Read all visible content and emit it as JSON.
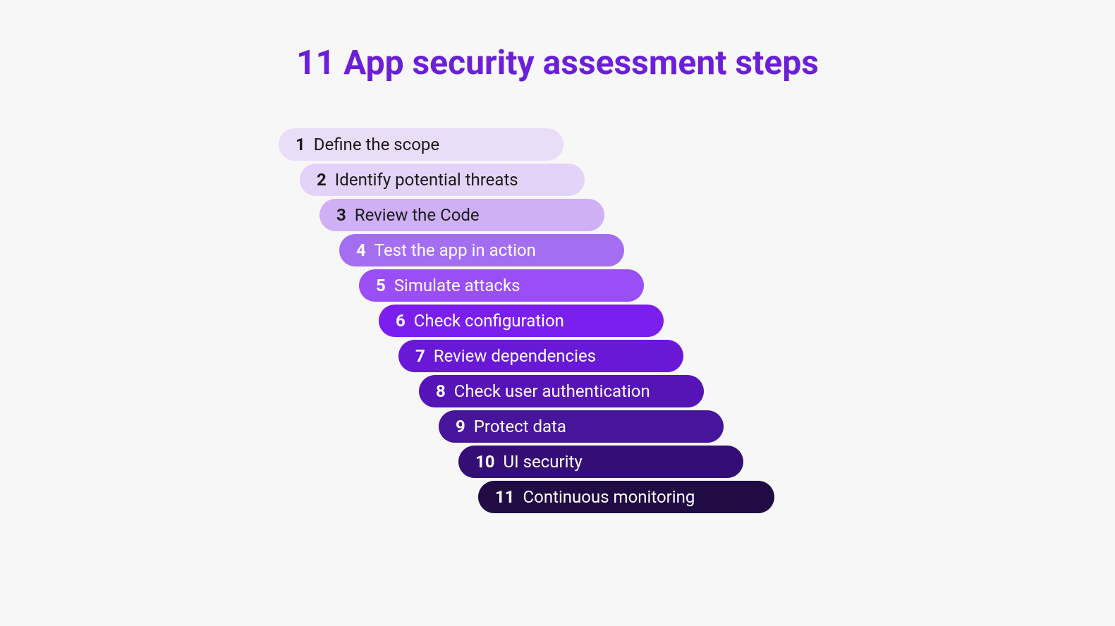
{
  "title": "11 App security assessment steps",
  "steps": [
    {
      "number": "1",
      "label": "Define the scope"
    },
    {
      "number": "2",
      "label": "Identify potential threats"
    },
    {
      "number": "3",
      "label": "Review the Code"
    },
    {
      "number": "4",
      "label": "Test the app in action"
    },
    {
      "number": "5",
      "label": "Simulate attacks"
    },
    {
      "number": "6",
      "label": "Check configuration"
    },
    {
      "number": "7",
      "label": "Review dependencies"
    },
    {
      "number": "8",
      "label": "Check user authentication"
    },
    {
      "number": "9",
      "label": "Protect data"
    },
    {
      "number": "10",
      "label": "UI security"
    },
    {
      "number": "11",
      "label": "Continuous monitoring"
    }
  ]
}
